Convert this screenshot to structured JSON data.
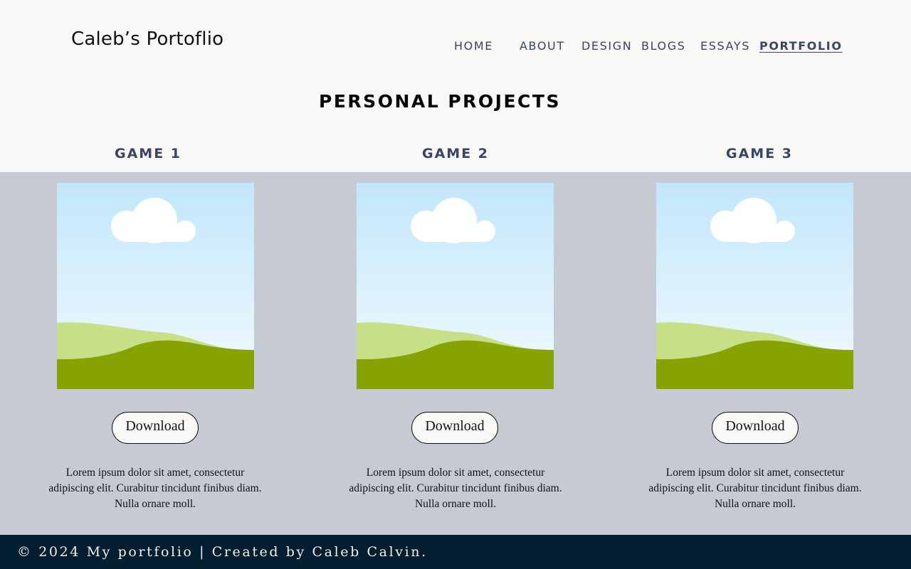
{
  "header": {
    "site_title": "Caleb’s Portoflio",
    "nav": [
      "HOME",
      "ABOUT",
      "DESIGN",
      "BLOGS",
      "ESSAYS",
      "PORTFOLIO"
    ],
    "active_nav": "PORTFOLIO"
  },
  "main": {
    "section_title": "PERSONAL PROJECTS",
    "projects": [
      {
        "title": "GAME 1",
        "thumbnail_icon": "landscape-placeholder-icon",
        "button_label": "Download",
        "description": "Lorem ipsum dolor sit amet, consectetur adipiscing elit. Curabitur tincidunt finibus diam. Nulla ornare moll."
      },
      {
        "title": "GAME 2",
        "thumbnail_icon": "landscape-placeholder-icon",
        "button_label": "Download",
        "description": "Lorem ipsum dolor sit amet, consectetur adipiscing elit. Curabitur tincidunt finibus diam. Nulla ornare moll."
      },
      {
        "title": "GAME 3",
        "thumbnail_icon": "landscape-placeholder-icon",
        "button_label": "Download",
        "description": "Lorem ipsum dolor sit amet, consectetur adipiscing elit. Curabitur tincidunt finibus diam. Nulla ornare moll."
      }
    ]
  },
  "footer": {
    "text": "© 2024 My portfolio | Created by Caleb Calvin."
  },
  "colors": {
    "page_bg": "#f9f8f6",
    "nav_text": "#3a4563",
    "band_bg": "#c6cad2",
    "footer_bg": "#011d30",
    "sky_top": "#c2e6fb",
    "light_hill": "#c7e087",
    "dark_hill": "#87a300"
  }
}
